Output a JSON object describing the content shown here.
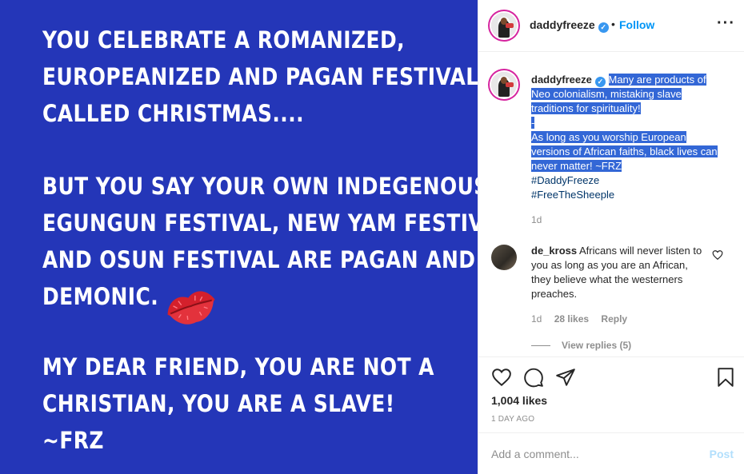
{
  "post_image": {
    "paragraph_1": [
      "YOU CELEBRATE A ROMANIZED,",
      "EUROPEANIZED AND PAGAN FESTIVAL",
      "CALLED CHRISTMAS...."
    ],
    "paragraph_2": [
      "BUT YOU SAY YOUR OWN INDEGENOUS",
      "EGUNGUN FESTIVAL, NEW YAM FESTIVAL",
      "AND OSUN FESTIVAL ARE PAGAN AND",
      "DEMONIC."
    ],
    "paragraph_3": [
      "MY DEAR FRIEND, YOU ARE NOT A",
      "CHRISTIAN, YOU ARE A SLAVE!",
      "~FRZ"
    ],
    "background_color": "#2436b8",
    "sticker": "lips-kiss-icon"
  },
  "header": {
    "username": "daddyfreeze",
    "separator": "•",
    "follow_label": "Follow",
    "more_icon": "more-options-icon"
  },
  "caption": {
    "username": "daddyfreeze",
    "line_1": "Many are products of Neo colonialism, mistaking slave traditions for spirituality!",
    "line_2": "-",
    "line_3": "As long as you worship European versions of African faiths, black lives can never matter! ~FRZ",
    "hashtag_1": "#DaddyFreeze",
    "hashtag_2": "#FreeTheSheeple",
    "time": "1d"
  },
  "comment": {
    "username": "de_kross",
    "text": "Africans will never listen to you as long as you are an African, they believe what the westerners preaches.",
    "time": "1d",
    "likes": "28 likes",
    "reply_label": "Reply",
    "view_replies": "View replies (5)"
  },
  "actions": {
    "likes": "1,004 likes",
    "date": "1 DAY AGO"
  },
  "add_comment": {
    "placeholder": "Add a comment...",
    "post_label": "Post"
  },
  "colors": {
    "accent": "#0095f6",
    "highlight": "#3367d6",
    "image_background": "#2436b8"
  }
}
